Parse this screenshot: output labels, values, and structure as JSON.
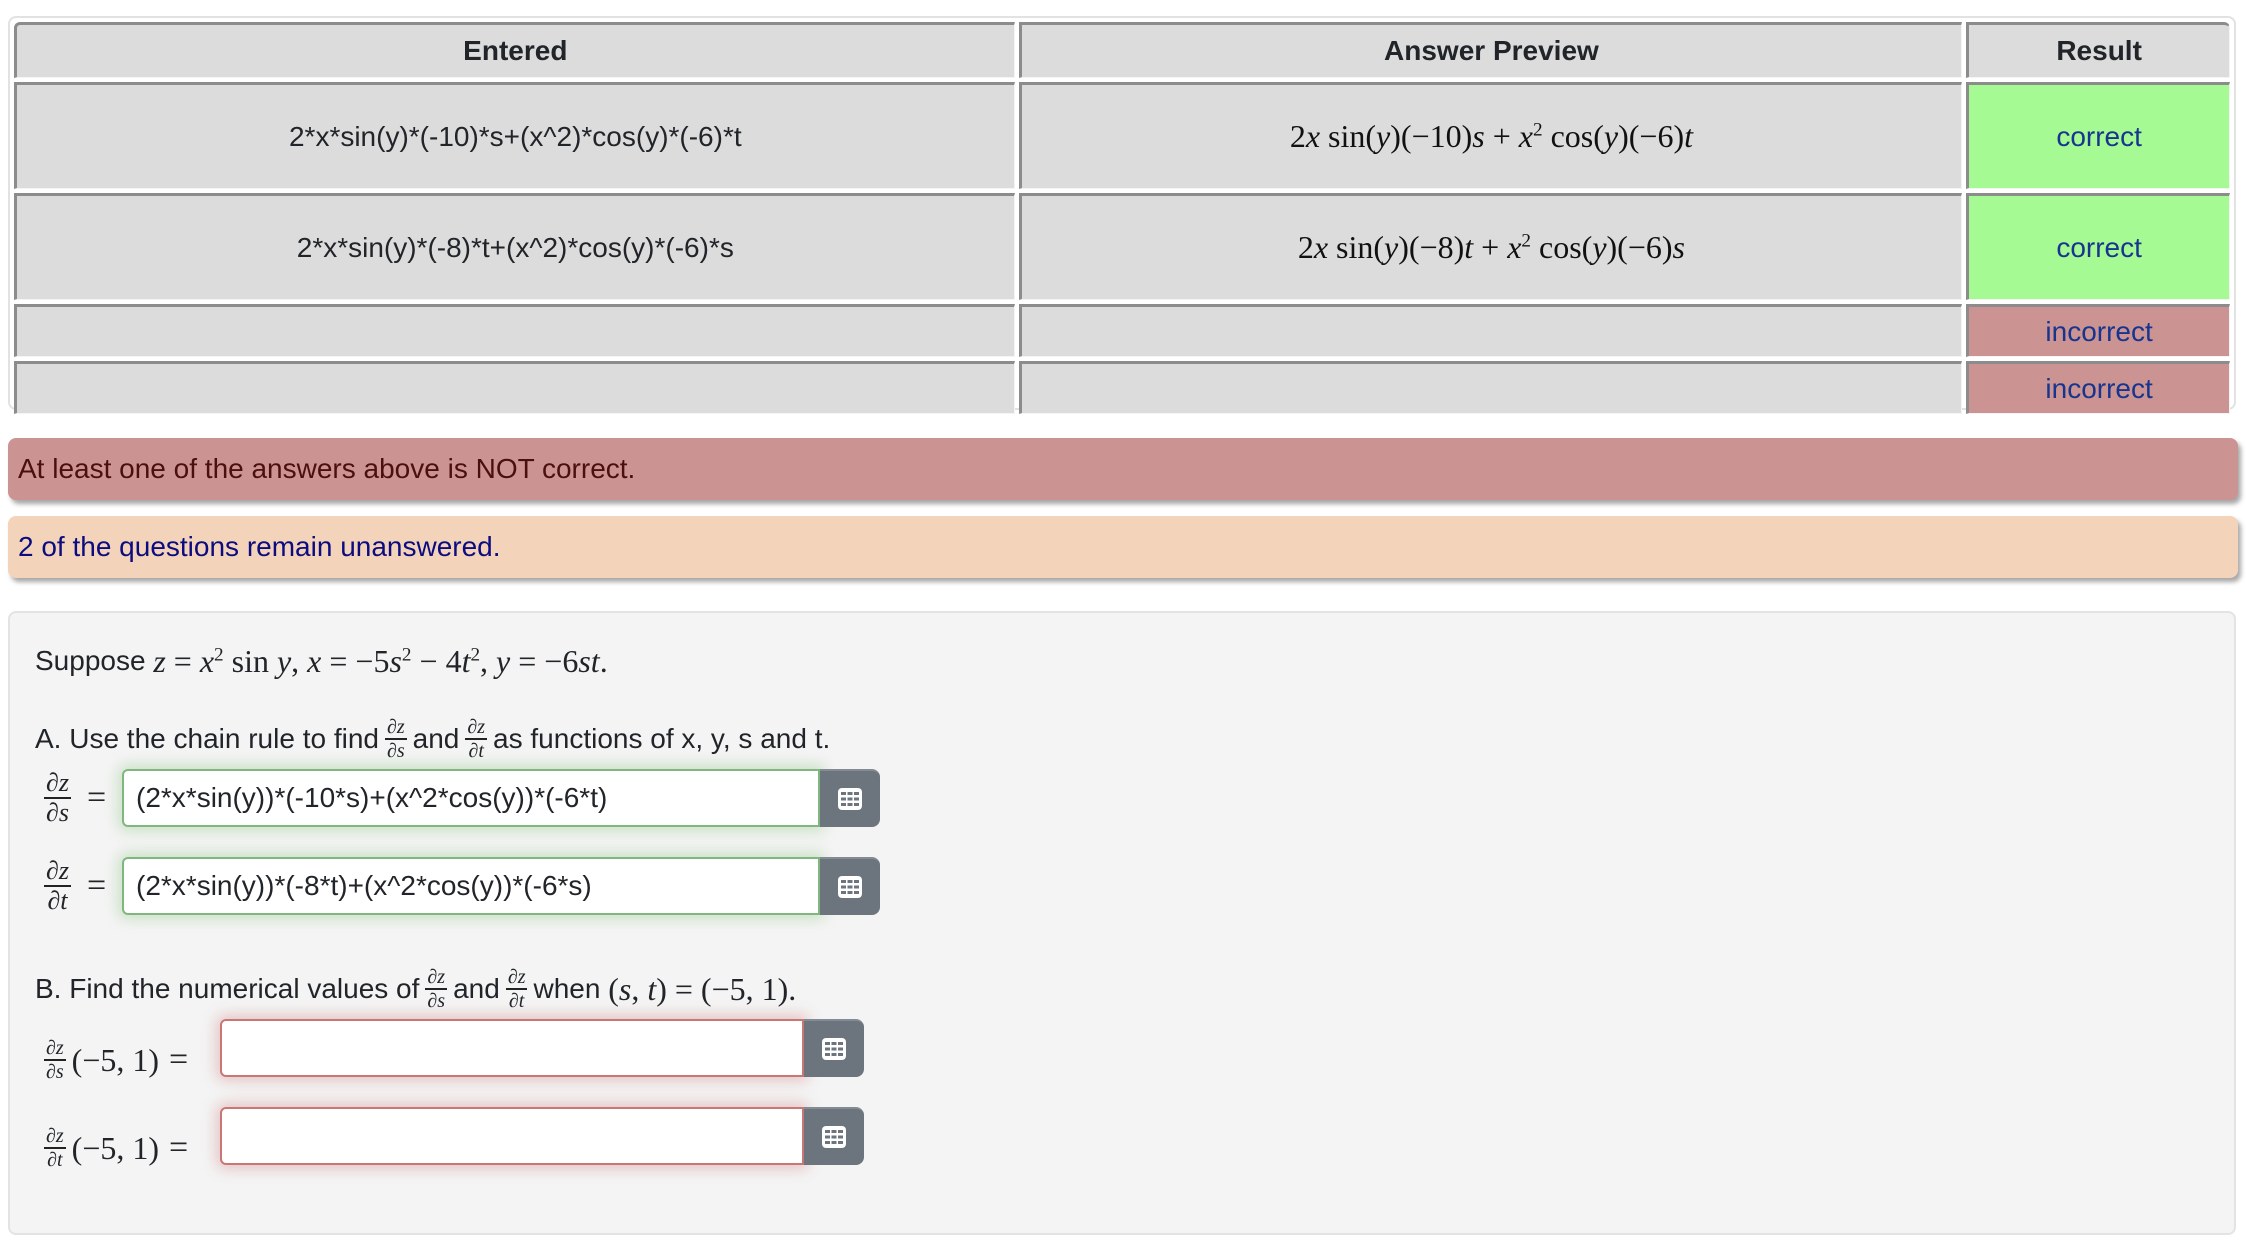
{
  "results_table": {
    "headers": [
      "Entered",
      "Answer Preview",
      "Result"
    ],
    "rows": [
      {
        "entered": "2*x*sin(y)*(-10)*s+(x^2)*cos(y)*(-6)*t",
        "preview": "2x sin(y)(−10)s + x² cos(y)(−6)t",
        "result": "correct"
      },
      {
        "entered": "2*x*sin(y)*(-8)*t+(x^2)*cos(y)*(-6)*s",
        "preview": "2x sin(y)(−8)t + x² cos(y)(−6)s",
        "result": "correct"
      },
      {
        "entered": "",
        "preview": "",
        "result": "incorrect"
      },
      {
        "entered": "",
        "preview": "",
        "result": "incorrect"
      }
    ]
  },
  "banners": {
    "error": "At least one of the answers above is NOT correct.",
    "warning": "2 of the questions remain unanswered."
  },
  "problem": {
    "intro_word": "Suppose",
    "given": {
      "z": "x² sin y",
      "x": "−5s² − 4t²",
      "y": "−6st"
    },
    "part_a": {
      "prefix": "A. Use the chain rule to find",
      "and": "and",
      "suffix": "as functions of x, y, s and t.",
      "answers": [
        {
          "label_num": "∂z",
          "label_den": "∂s",
          "value": "(2*x*sin(y))*(-10*s)+(x^2*cos(y))*(-6*t)",
          "status": "correct"
        },
        {
          "label_num": "∂z",
          "label_den": "∂t",
          "value": "(2*x*sin(y))*(-8*t)+(x^2*cos(y))*(-6*s)",
          "status": "correct"
        }
      ]
    },
    "part_b": {
      "prefix": "B. Find the numerical values of",
      "and": "and",
      "when": "when",
      "point_vars": "(s, t)",
      "point_value": "(−5, 1)",
      "answers": [
        {
          "label_num": "∂z",
          "label_den": "∂s",
          "arg": "(−5, 1)",
          "value": "",
          "status": "incorrect"
        },
        {
          "label_num": "∂z",
          "label_den": "∂t",
          "arg": "(−5, 1)",
          "value": "",
          "status": "incorrect"
        }
      ]
    },
    "keyboard_icon": "grid-keypad-icon"
  },
  "colors": {
    "correct_bg": "#a6fa93",
    "incorrect_bg": "#cc9393",
    "warning_bg": "#f3d3b9",
    "button_gray": "#6c757d"
  }
}
